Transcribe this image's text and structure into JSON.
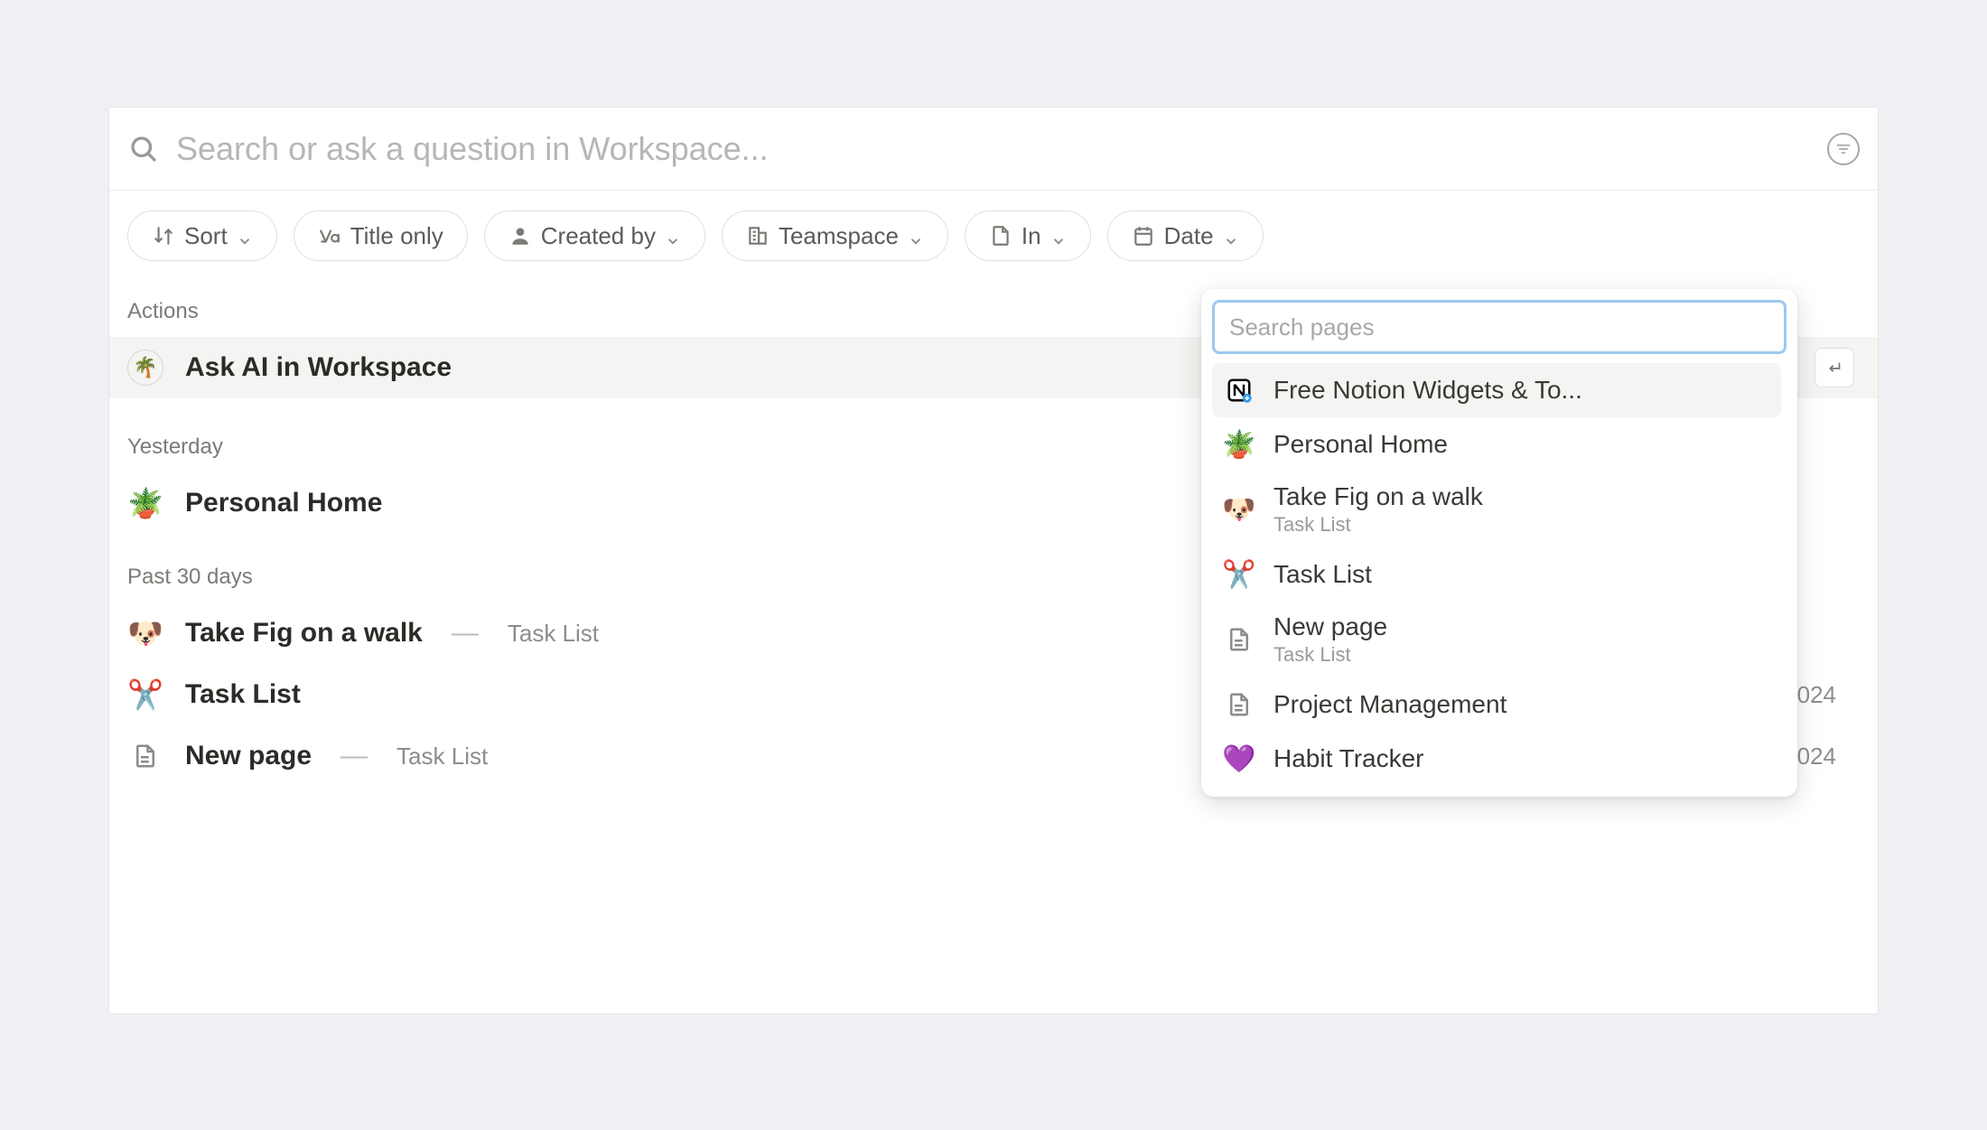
{
  "search": {
    "placeholder": "Search or ask a question in Workspace..."
  },
  "filters": {
    "sort": "Sort",
    "title_only": "Title only",
    "created_by": "Created by",
    "teamspace": "Teamspace",
    "in": "In",
    "date": "Date"
  },
  "sections": {
    "actions_label": "Actions",
    "yesterday_label": "Yesterday",
    "past30_label": "Past 30 days"
  },
  "results": {
    "ask_ai": "Ask AI in Workspace",
    "yesterday": {
      "title": "Personal Home",
      "emoji": "🪴"
    },
    "past30": [
      {
        "emoji": "🐶",
        "title": "Take Fig on a walk",
        "sub": "Task List",
        "trailing": ""
      },
      {
        "emoji": "✂️",
        "title": "Task List",
        "sub": "",
        "trailing": "024"
      },
      {
        "emoji": "page",
        "title": "New page",
        "sub": "Task List",
        "trailing": "024"
      }
    ]
  },
  "dropdown": {
    "search_placeholder": "Search pages",
    "items": [
      {
        "icon": "notion",
        "title": "Free Notion Widgets & To...",
        "sub": ""
      },
      {
        "icon": "🪴",
        "title": "Personal Home",
        "sub": ""
      },
      {
        "icon": "🐶",
        "title": "Take Fig on a walk",
        "sub": "Task List"
      },
      {
        "icon": "✂️",
        "title": "Task List",
        "sub": ""
      },
      {
        "icon": "page",
        "title": "New page",
        "sub": "Task List"
      },
      {
        "icon": "page",
        "title": "Project Management",
        "sub": ""
      },
      {
        "icon": "💜",
        "title": "Habit Tracker",
        "sub": ""
      }
    ]
  },
  "icons": {
    "ai_emoji": "🌴",
    "separator": "—"
  }
}
